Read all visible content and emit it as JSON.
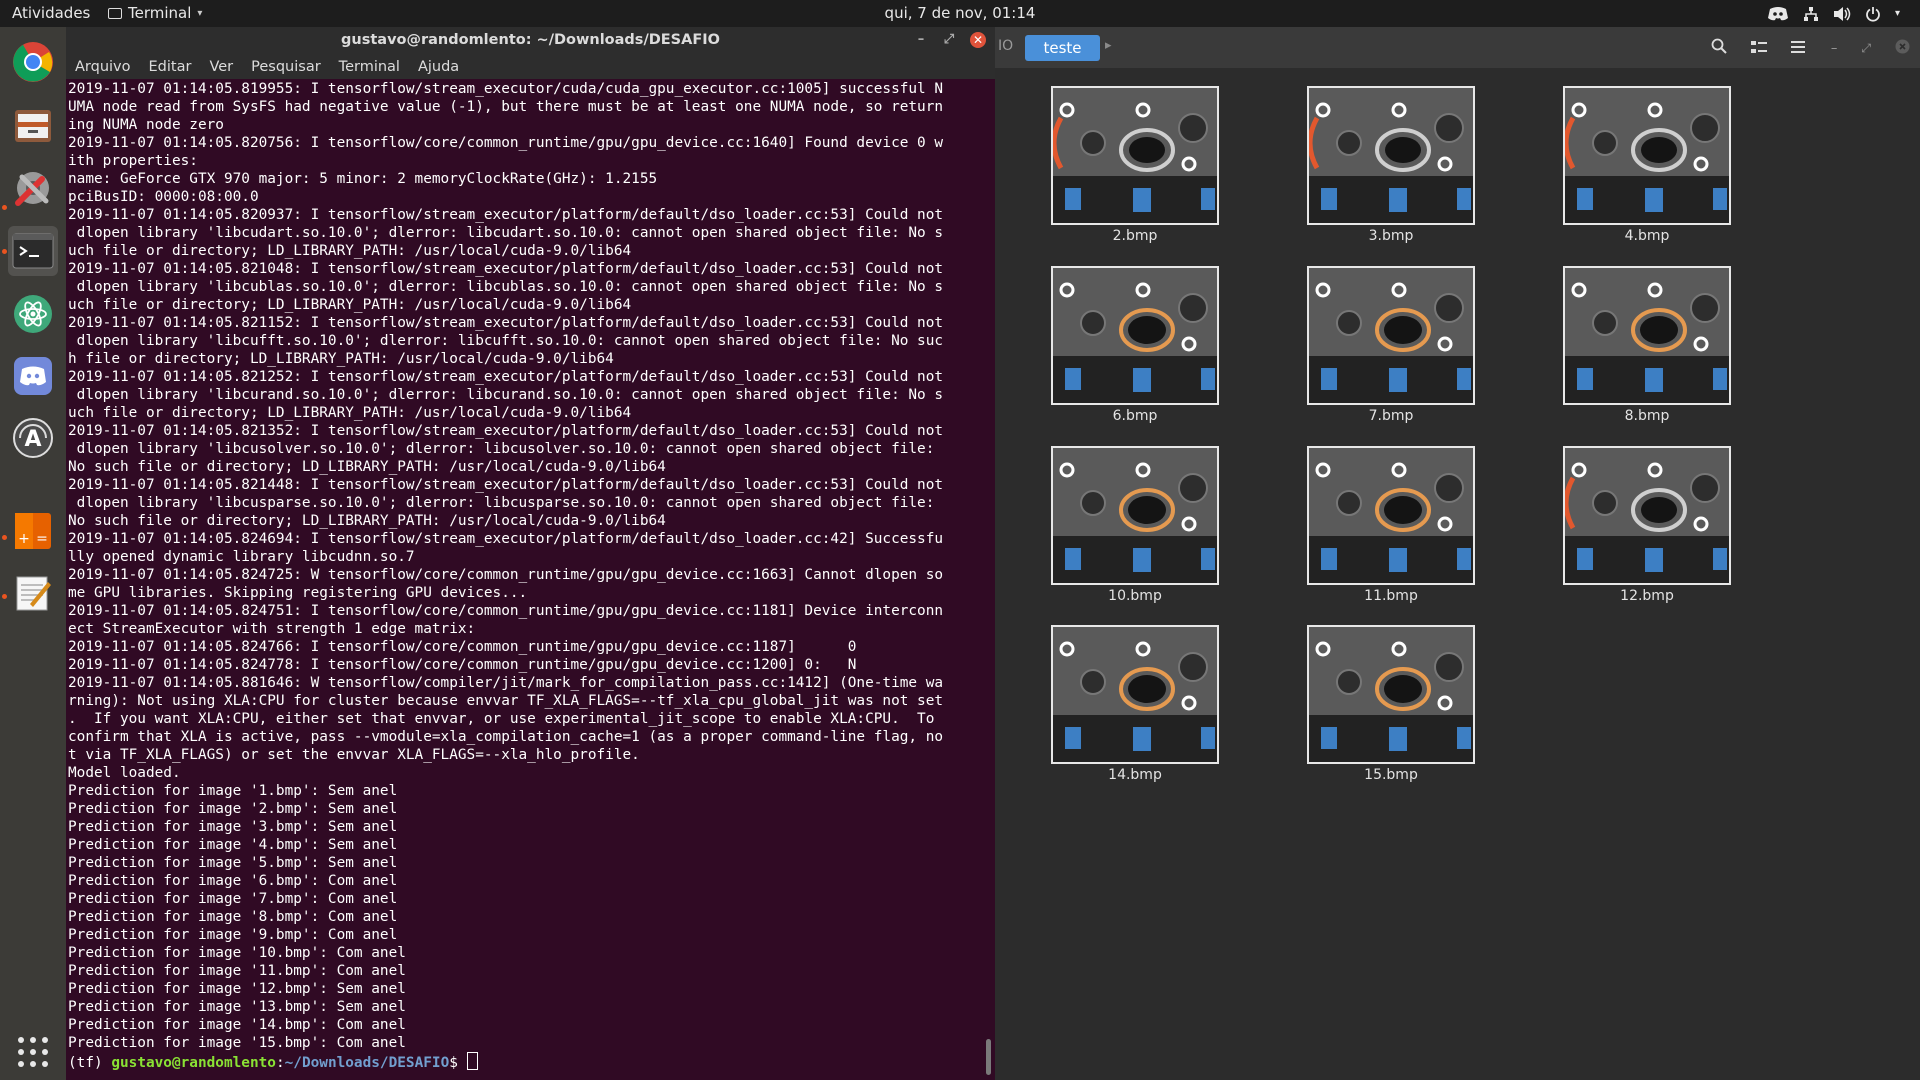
{
  "topbar": {
    "activities": "Atividades",
    "app_menu": "Terminal",
    "clock": "qui, 7 de nov, 01:14"
  },
  "dock": {
    "items": [
      {
        "name": "chrome-icon"
      },
      {
        "name": "files-icon"
      },
      {
        "name": "settings-tools-icon"
      },
      {
        "name": "terminal-icon"
      },
      {
        "name": "atom-icon"
      },
      {
        "name": "discord-icon"
      },
      {
        "name": "software-updater-icon"
      },
      {
        "name": "calculator-icon"
      },
      {
        "name": "text-editor-icon"
      },
      {
        "name": "show-applications-icon"
      }
    ]
  },
  "terminal": {
    "title": "gustavo@randomlento: ~/Downloads/DESAFIO",
    "menu": [
      "Arquivo",
      "Editar",
      "Ver",
      "Pesquisar",
      "Terminal",
      "Ajuda"
    ],
    "lines": [
      "2019-11-07 01:14:05.819955: I tensorflow/stream_executor/cuda/cuda_gpu_executor.cc:1005] successful N",
      "UMA node read from SysFS had negative value (-1), but there must be at least one NUMA node, so return",
      "ing NUMA node zero",
      "2019-11-07 01:14:05.820756: I tensorflow/core/common_runtime/gpu/gpu_device.cc:1640] Found device 0 w",
      "ith properties:",
      "name: GeForce GTX 970 major: 5 minor: 2 memoryClockRate(GHz): 1.2155",
      "pciBusID: 0000:08:00.0",
      "2019-11-07 01:14:05.820937: I tensorflow/stream_executor/platform/default/dso_loader.cc:53] Could not",
      " dlopen library 'libcudart.so.10.0'; dlerror: libcudart.so.10.0: cannot open shared object file: No s",
      "uch file or directory; LD_LIBRARY_PATH: /usr/local/cuda-9.0/lib64",
      "2019-11-07 01:14:05.821048: I tensorflow/stream_executor/platform/default/dso_loader.cc:53] Could not",
      " dlopen library 'libcublas.so.10.0'; dlerror: libcublas.so.10.0: cannot open shared object file: No s",
      "uch file or directory; LD_LIBRARY_PATH: /usr/local/cuda-9.0/lib64",
      "2019-11-07 01:14:05.821152: I tensorflow/stream_executor/platform/default/dso_loader.cc:53] Could not",
      " dlopen library 'libcufft.so.10.0'; dlerror: libcufft.so.10.0: cannot open shared object file: No suc",
      "h file or directory; LD_LIBRARY_PATH: /usr/local/cuda-9.0/lib64",
      "2019-11-07 01:14:05.821252: I tensorflow/stream_executor/platform/default/dso_loader.cc:53] Could not",
      " dlopen library 'libcurand.so.10.0'; dlerror: libcurand.so.10.0: cannot open shared object file: No s",
      "uch file or directory; LD_LIBRARY_PATH: /usr/local/cuda-9.0/lib64",
      "2019-11-07 01:14:05.821352: I tensorflow/stream_executor/platform/default/dso_loader.cc:53] Could not",
      " dlopen library 'libcusolver.so.10.0'; dlerror: libcusolver.so.10.0: cannot open shared object file:",
      "No such file or directory; LD_LIBRARY_PATH: /usr/local/cuda-9.0/lib64",
      "2019-11-07 01:14:05.821448: I tensorflow/stream_executor/platform/default/dso_loader.cc:53] Could not",
      " dlopen library 'libcusparse.so.10.0'; dlerror: libcusparse.so.10.0: cannot open shared object file:",
      "No such file or directory; LD_LIBRARY_PATH: /usr/local/cuda-9.0/lib64",
      "2019-11-07 01:14:05.824694: I tensorflow/stream_executor/platform/default/dso_loader.cc:42] Successfu",
      "lly opened dynamic library libcudnn.so.7",
      "2019-11-07 01:14:05.824725: W tensorflow/core/common_runtime/gpu/gpu_device.cc:1663] Cannot dlopen so",
      "me GPU libraries. Skipping registering GPU devices...",
      "2019-11-07 01:14:05.824751: I tensorflow/core/common_runtime/gpu/gpu_device.cc:1181] Device interconn",
      "ect StreamExecutor with strength 1 edge matrix:",
      "2019-11-07 01:14:05.824766: I tensorflow/core/common_runtime/gpu/gpu_device.cc:1187]      0",
      "2019-11-07 01:14:05.824778: I tensorflow/core/common_runtime/gpu/gpu_device.cc:1200] 0:   N",
      "2019-11-07 01:14:05.881646: W tensorflow/compiler/jit/mark_for_compilation_pass.cc:1412] (One-time wa",
      "rning): Not using XLA:CPU for cluster because envvar TF_XLA_FLAGS=--tf_xla_cpu_global_jit was not set",
      ".  If you want XLA:CPU, either set that envvar, or use experimental_jit_scope to enable XLA:CPU.  To",
      "confirm that XLA is active, pass --vmodule=xla_compilation_cache=1 (as a proper command-line flag, no",
      "t via TF_XLA_FLAGS) or set the envvar XLA_FLAGS=--xla_hlo_profile.",
      "Model loaded.",
      "Prediction for image '1.bmp': Sem anel",
      "Prediction for image '2.bmp': Sem anel",
      "Prediction for image '3.bmp': Sem anel",
      "Prediction for image '4.bmp': Sem anel",
      "Prediction for image '5.bmp': Sem anel",
      "Prediction for image '6.bmp': Com anel",
      "Prediction for image '7.bmp': Com anel",
      "Prediction for image '8.bmp': Com anel",
      "Prediction for image '9.bmp': Com anel",
      "Prediction for image '10.bmp': Com anel",
      "Prediction for image '11.bmp': Com anel",
      "Prediction for image '12.bmp': Sem anel",
      "Prediction for image '13.bmp': Sem anel",
      "Prediction for image '14.bmp': Com anel",
      "Prediction for image '15.bmp': Com anel"
    ],
    "prompt": {
      "env": "(tf) ",
      "user_host": "gustavo@randomlento",
      "sep": ":",
      "path": "~/Downloads/DESAFIO",
      "symbol": "$ "
    }
  },
  "files": {
    "breadcrumb_prev": "IO",
    "breadcrumb_current": "teste",
    "items": [
      {
        "name": "2.bmp",
        "ring": "orange-left"
      },
      {
        "name": "3.bmp",
        "ring": "orange-left"
      },
      {
        "name": "4.bmp",
        "ring": "orange-left"
      },
      {
        "name": "6.bmp",
        "ring": "center"
      },
      {
        "name": "7.bmp",
        "ring": "center"
      },
      {
        "name": "8.bmp",
        "ring": "center"
      },
      {
        "name": "10.bmp",
        "ring": "center"
      },
      {
        "name": "11.bmp",
        "ring": "center"
      },
      {
        "name": "12.bmp",
        "ring": "orange-left"
      },
      {
        "name": "14.bmp",
        "ring": "center"
      },
      {
        "name": "15.bmp",
        "ring": "center"
      }
    ]
  },
  "colors": {
    "terminal_bg": "#300a24",
    "accent": "#4a90d9",
    "ubuntu_orange": "#e95420",
    "prompt_user": "#8ae234",
    "prompt_path": "#729fcf"
  }
}
